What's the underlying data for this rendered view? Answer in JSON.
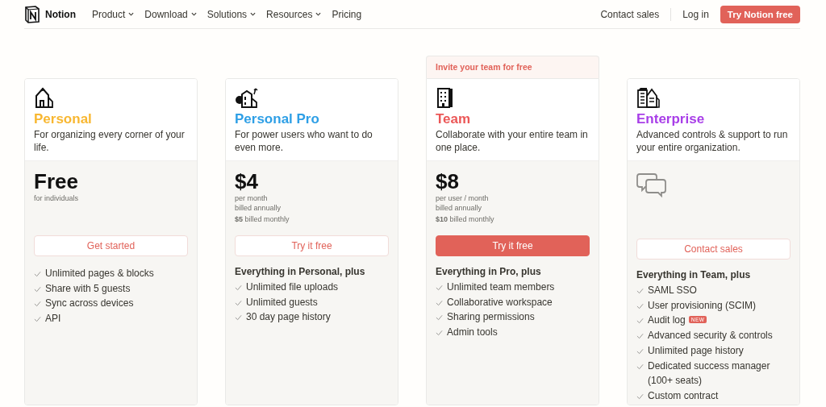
{
  "nav": {
    "brand": "Notion",
    "menu": [
      {
        "label": "Product",
        "dropdown": true
      },
      {
        "label": "Download",
        "dropdown": true
      },
      {
        "label": "Solutions",
        "dropdown": true
      },
      {
        "label": "Resources",
        "dropdown": true
      },
      {
        "label": "Pricing",
        "dropdown": false
      }
    ],
    "contact": "Contact sales",
    "login": "Log in",
    "cta": "Try Notion free"
  },
  "plans": [
    {
      "name": "Personal",
      "color": "#f8b731",
      "description": "For organizing every corner of your life.",
      "price": "Free",
      "price_lines": [
        "for individuals"
      ],
      "button": {
        "label": "Get started",
        "primary": false
      },
      "features": [
        {
          "text": "Unlimited pages & blocks"
        },
        {
          "text": "Share with 5 guests"
        },
        {
          "text": "Sync across devices"
        },
        {
          "text": "API"
        }
      ]
    },
    {
      "name": "Personal Pro",
      "color": "#2e9fe6",
      "description": "For power users who want to do even more.",
      "price": "$4",
      "price_lines": [
        "per month",
        "billed annually"
      ],
      "monthly": "**$5** billed monthly",
      "button": {
        "label": "Try it free",
        "primary": false
      },
      "features_heading": "Everything in Personal, plus",
      "features": [
        {
          "text": "Unlimited file uploads"
        },
        {
          "text": "Unlimited guests"
        },
        {
          "text": "30 day page history"
        }
      ]
    },
    {
      "banner": "Invite your team for free",
      "name": "Team",
      "color": "#eb5757",
      "description": "Collaborate with your entire team in one place.",
      "price": "$8",
      "price_lines": [
        "per user / month",
        "billed annually"
      ],
      "monthly": "**$10** billed monthly",
      "button": {
        "label": "Try it free",
        "primary": true
      },
      "features_heading": "Everything in Pro, plus",
      "features": [
        {
          "text": "Unlimited team members"
        },
        {
          "text": "Collaborative workspace"
        },
        {
          "text": "Sharing permissions"
        },
        {
          "text": "Admin tools"
        }
      ]
    },
    {
      "name": "Enterprise",
      "color": "#a83ee8",
      "description": "Advanced controls & support to run your entire organization.",
      "button": {
        "label": "Contact sales",
        "primary": false
      },
      "features_heading": "Everything in Team, plus",
      "features": [
        {
          "text": "SAML SSO"
        },
        {
          "text": "User provisioning (SCIM)"
        },
        {
          "text": "Audit log",
          "badge": "NEW"
        },
        {
          "text": "Advanced security & controls"
        },
        {
          "text": "Unlimited page history"
        },
        {
          "text": "Dedicated success manager (100+ seats)"
        },
        {
          "text": "Custom contract"
        }
      ]
    }
  ]
}
